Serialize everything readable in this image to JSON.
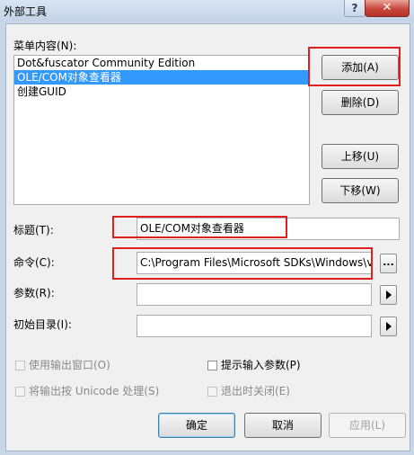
{
  "window": {
    "title": "外部工具",
    "help": "?",
    "close": "✕"
  },
  "menu_label": "菜单内容(N):",
  "menu_items": [
    "Dot&fuscator Community Edition",
    "OLE/COM对象查看器",
    "创建GUID"
  ],
  "selected_index": 1,
  "buttons": {
    "add": "添加(A)",
    "delete": "删除(D)",
    "move_up": "上移(U)",
    "move_down": "下移(W)"
  },
  "fields": {
    "title_label": "标题(T):",
    "title_value": "OLE/COM对象查看器",
    "command_label": "命令(C):",
    "command_value": "C:\\Program Files\\Microsoft SDKs\\Windows\\v",
    "command_browse": "...",
    "args_label": "参数(R):",
    "args_value": "",
    "initdir_label": "初始目录(I):",
    "initdir_value": ""
  },
  "options": {
    "use_output": "使用输出窗口(O)",
    "prompt_args": "提示输入参数(P)",
    "unicode_output": "将输出按 Unicode 处理(S)",
    "close_on_exit": "退出时关闭(E)"
  },
  "footer": {
    "ok": "确定",
    "cancel": "取消",
    "apply": "应用(L)"
  }
}
